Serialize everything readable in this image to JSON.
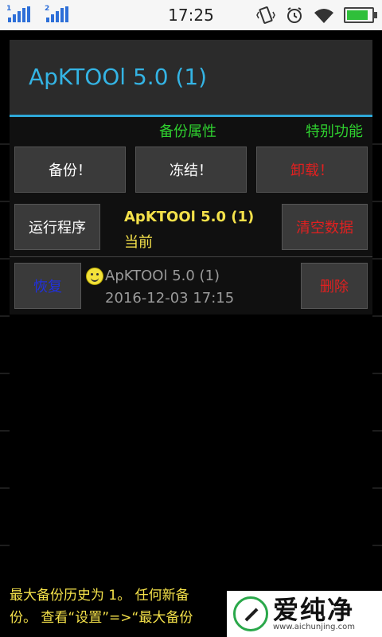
{
  "statusbar": {
    "time": "17:25",
    "sim1": "1",
    "sim2": "2"
  },
  "dialog": {
    "title": "ApKTOOl 5.0 (1)",
    "tabs": {
      "backup": "备份属性",
      "special": "特别功能"
    },
    "buttons": {
      "backup": "备份！",
      "freeze": "冻结！",
      "uninstall": "卸载！",
      "run": "运行程序",
      "clear_data": "清空数据",
      "restore": "恢复",
      "delete": "删除"
    },
    "current_app": {
      "name": "ApKTOOl 5.0 (1)",
      "label": "当前"
    },
    "history": {
      "name": "ApKTOOl 5.0 (1)",
      "date": "2016-12-03 17:15"
    }
  },
  "footer": {
    "line1": "最大备份历史为 1。 任何新备",
    "line2": "份。 查看“设置”=>“最大备份"
  },
  "watermark": {
    "brand": "爱纯净",
    "url": "www.aichunjing.com"
  },
  "colors": {
    "accent": "#34b4e4",
    "tab_green": "#2fd12f",
    "app_yellow": "#f4e14a",
    "danger": "#e02020",
    "restore_blue": "#2030e0"
  }
}
